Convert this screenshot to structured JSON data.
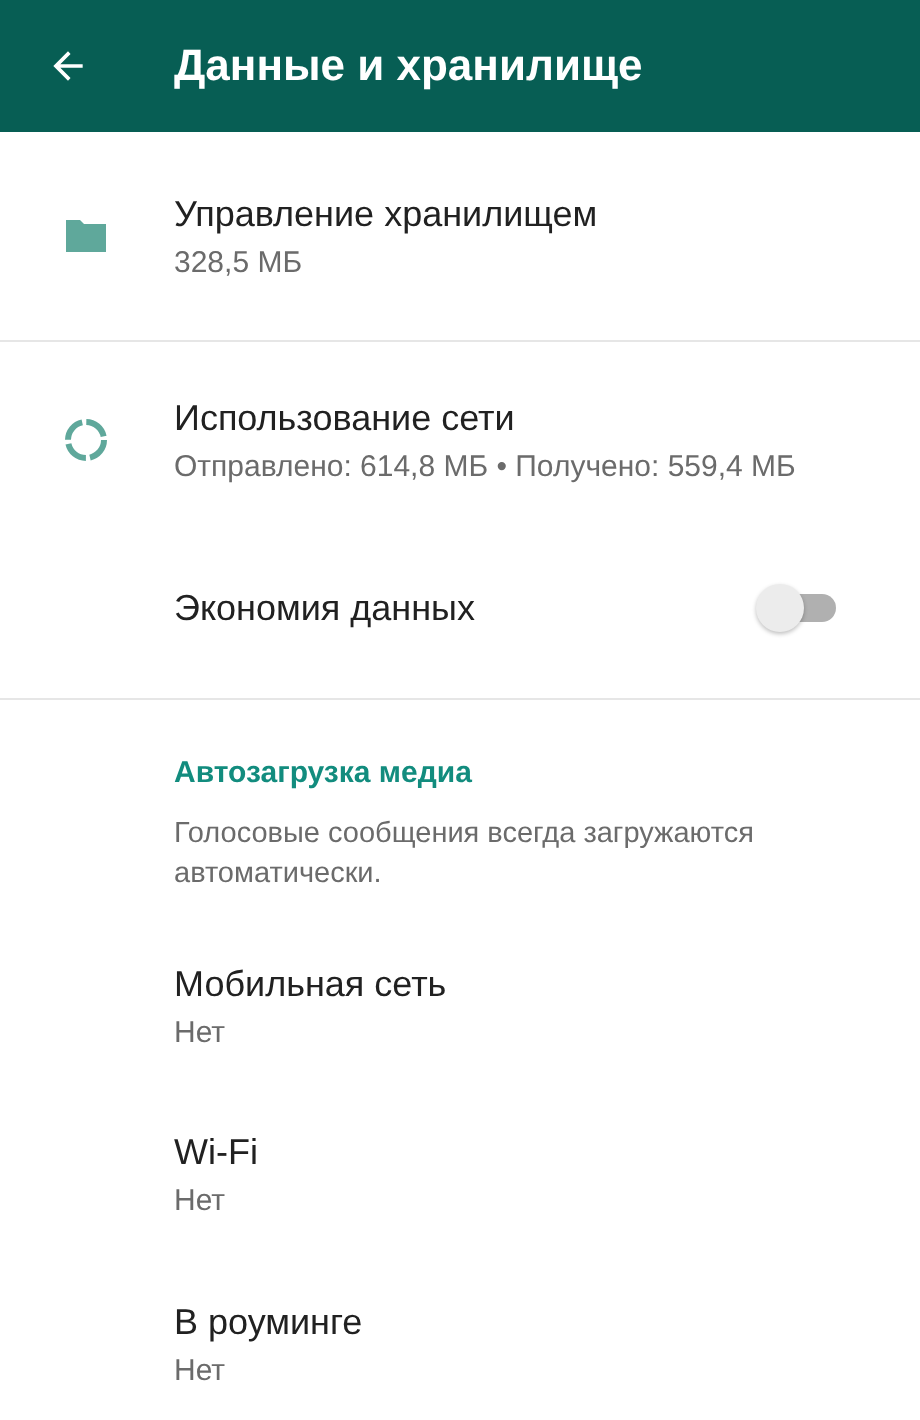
{
  "toolbar": {
    "title": "Данные и хранилище"
  },
  "storage": {
    "title": "Управление хранилищем",
    "subtitle": "328,5 МБ"
  },
  "network": {
    "title": "Использование сети",
    "subtitle": "Отправлено: 614,8 МБ • Получено: 559,4 МБ"
  },
  "data_saver": {
    "label": "Экономия данных",
    "on": false
  },
  "media_autodownload": {
    "header": "Автозагрузка медиа",
    "note": "Голосовые сообщения всегда загружаются автоматически.",
    "items": [
      {
        "title": "Мобильная сеть",
        "value": "Нет"
      },
      {
        "title": "Wi-Fi",
        "value": "Нет"
      },
      {
        "title": "В роуминге",
        "value": "Нет"
      }
    ]
  }
}
